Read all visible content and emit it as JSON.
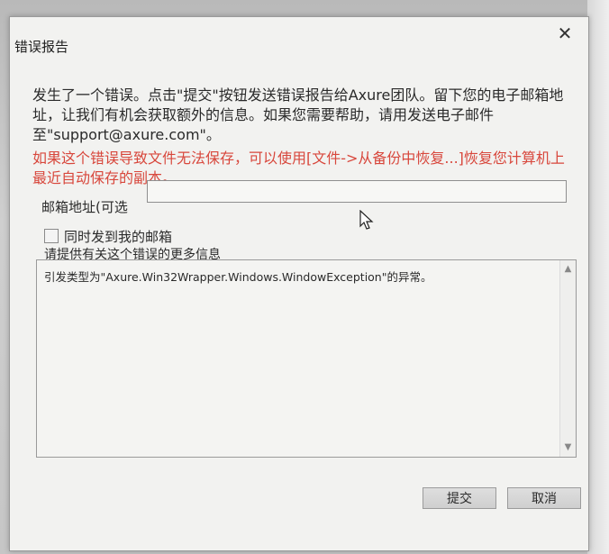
{
  "dialog": {
    "title": "错误报告",
    "close_glyph": "✕",
    "message": "发生了一个错误。点击\"提交\"按钮发送错误报告给Axure团队。留下您的电子邮箱地址，让我们有机会获取额外的信息。如果您需要帮助，请用发送电子邮件至\"support@axure.com\"。",
    "warning": "如果这个错误导致文件无法保存，可以使用[文件->从备份中恢复...]恢复您计算机上最近自动保存的副本。",
    "warning_color": "#d8473c",
    "email": {
      "label": "邮箱地址(可选",
      "value": ""
    },
    "cc_checkbox": {
      "label": "同时发到我的邮箱",
      "checked": false
    },
    "details": {
      "label": "请提供有关这个错误的更多信息",
      "text": "引发类型为\"Axure.Win32Wrapper.Windows.WindowException\"的异常。"
    },
    "buttons": {
      "submit": "提交",
      "cancel": "取消"
    }
  }
}
